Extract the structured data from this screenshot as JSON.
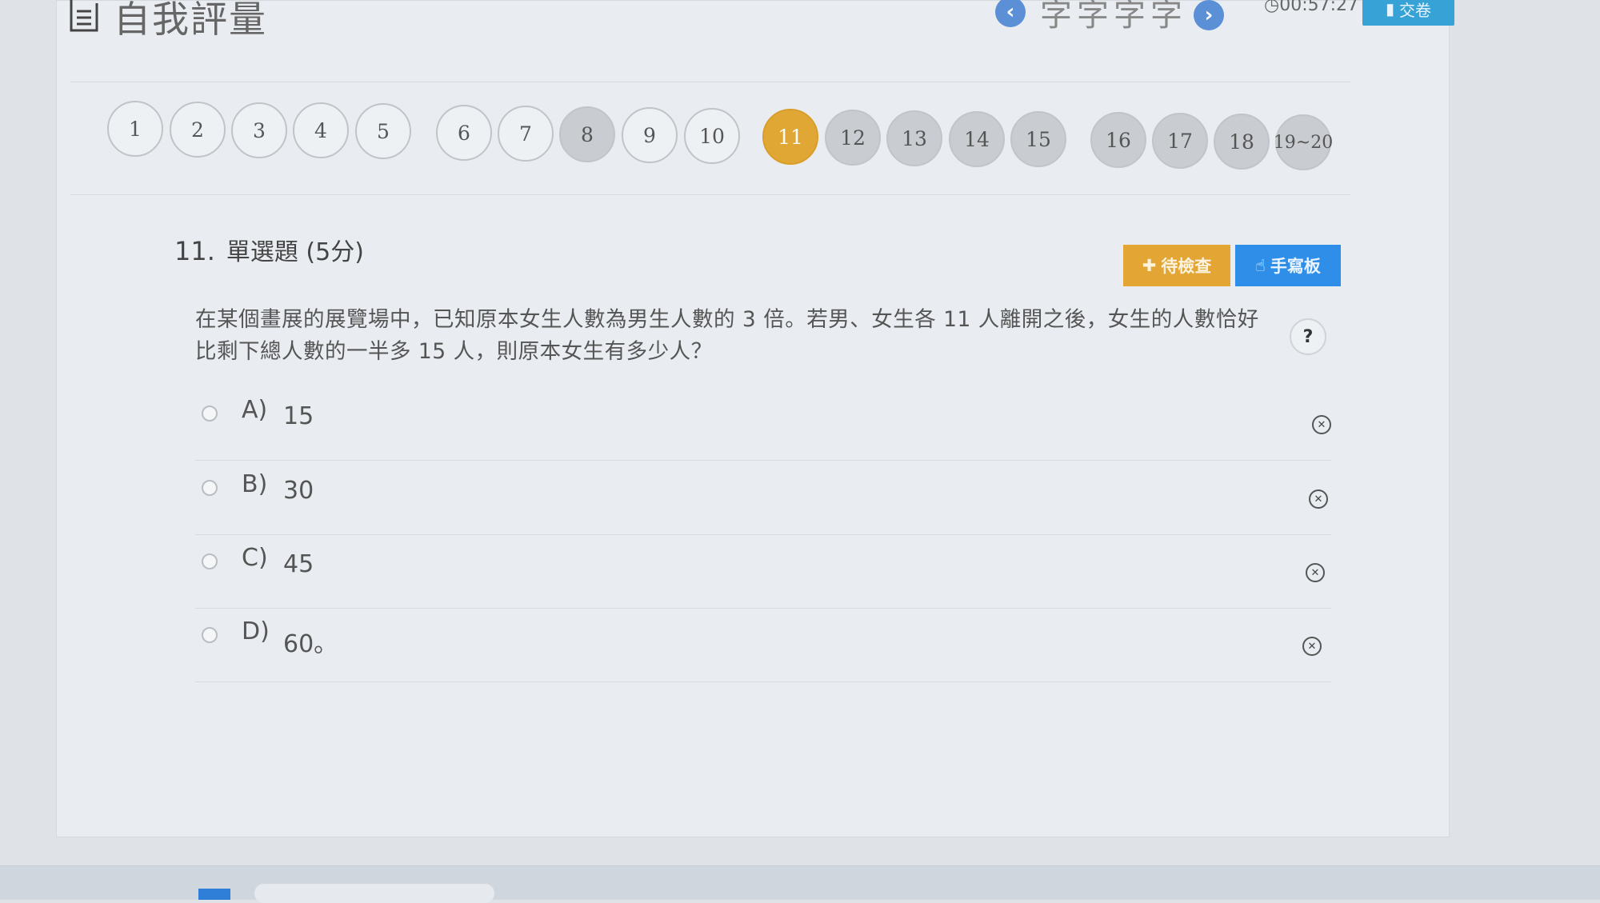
{
  "header": {
    "title": "自我評量",
    "name": "字字字字",
    "timer": "00:57:27",
    "submit_label": "交卷",
    "prev_icon": "chevron-left-icon",
    "next_icon": "chevron-right-icon"
  },
  "question_nav": [
    {
      "label": "1",
      "state": "unanswered"
    },
    {
      "label": "2",
      "state": "unanswered"
    },
    {
      "label": "3",
      "state": "unanswered"
    },
    {
      "label": "4",
      "state": "unanswered"
    },
    {
      "label": "5",
      "state": "unanswered"
    },
    {
      "label": "6",
      "state": "unanswered"
    },
    {
      "label": "7",
      "state": "unanswered"
    },
    {
      "label": "8",
      "state": "answered"
    },
    {
      "label": "9",
      "state": "unanswered"
    },
    {
      "label": "10",
      "state": "unanswered"
    },
    {
      "label": "11",
      "state": "current"
    },
    {
      "label": "12",
      "state": "answered"
    },
    {
      "label": "13",
      "state": "answered"
    },
    {
      "label": "14",
      "state": "answered"
    },
    {
      "label": "15",
      "state": "answered"
    },
    {
      "label": "16",
      "state": "answered"
    },
    {
      "label": "17",
      "state": "answered"
    },
    {
      "label": "18",
      "state": "answered"
    },
    {
      "label": "19~20",
      "state": "answered"
    }
  ],
  "question": {
    "number": "11.",
    "type": "單選題 (5分)",
    "text": "在某個畫展的展覽場中，已知原本女生人數為男生人數的 3 倍。若男、女生各 11 人離開之後，女生的人數恰好比剩下總人數的一半多 15 人，則原本女生有多少人？",
    "help_label": "?",
    "check_label": "待檢查",
    "pad_label": "手寫板",
    "options": [
      {
        "letter": "A)",
        "text": "15"
      },
      {
        "letter": "B)",
        "text": "30"
      },
      {
        "letter": "C)",
        "text": "45"
      },
      {
        "letter": "D)",
        "text": "60。"
      }
    ],
    "eliminate_icon": "close-circle-icon"
  },
  "colors": {
    "current": "#e0a735",
    "answered": "#c9ccd0",
    "check_button": "#e3a533",
    "pad_button": "#2f8ee8",
    "submit_button": "#36a2d6"
  }
}
